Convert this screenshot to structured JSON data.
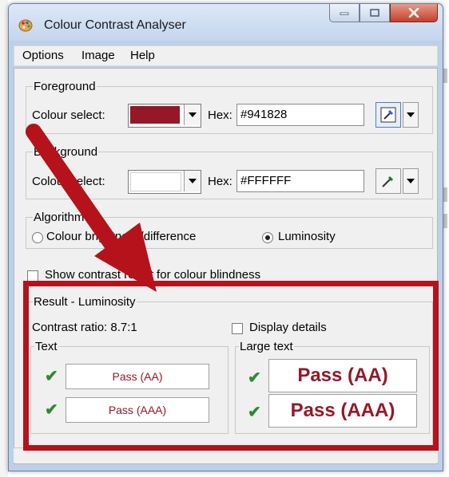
{
  "window": {
    "title": "Colour Contrast Analyser"
  },
  "menu": [
    "Options",
    "Image",
    "Help"
  ],
  "foreground": {
    "legend": "Foreground",
    "colour_select_label": "Colour select:",
    "swatch_color": "#941828",
    "hex_label": "Hex:",
    "hex_value": "#941828"
  },
  "background": {
    "legend": "Background",
    "colour_select_label": "Colour select:",
    "swatch_color": "#FFFFFF",
    "hex_label": "Hex:",
    "hex_value": "#FFFFFF"
  },
  "algorithm": {
    "legend": "Algorithm",
    "option_brightness": "Colour brightness/difference",
    "option_luminosity": "Luminosity",
    "selected": "Luminosity"
  },
  "show_blindness_label": "Show contrast result for colour blindness",
  "result": {
    "legend": "Result - Luminosity",
    "contrast_ratio": "Contrast ratio: 8.7:1",
    "display_details_label": "Display details",
    "text_legend": "Text",
    "large_text_legend": "Large text",
    "text_aa": "Pass (AA)",
    "text_aaa": "Pass (AAA)",
    "large_aa": "Pass (AA)",
    "large_aaa": "Pass (AAA)"
  },
  "colors": {
    "accent_red": "#941828",
    "highlight_red": "#b5121b",
    "pass_green": "#2e8b2e"
  },
  "icons": [
    "app-palette-icon",
    "eyedropper-icon",
    "check-icon",
    "dropdown-arrow-icon"
  ]
}
